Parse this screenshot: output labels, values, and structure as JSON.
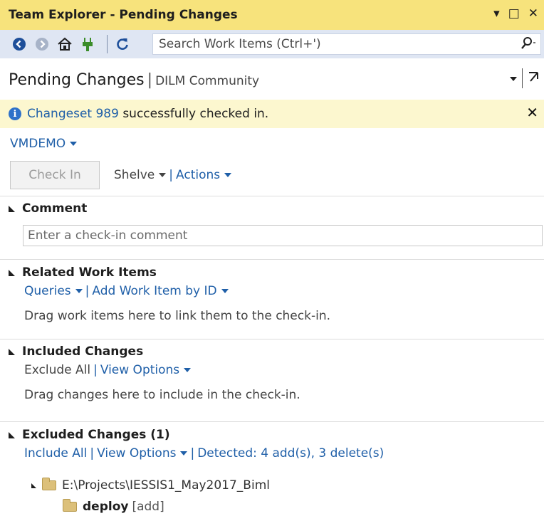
{
  "window": {
    "title": "Team Explorer - Pending Changes",
    "controls": [
      "▾",
      "□",
      "✕"
    ]
  },
  "toolbar": {
    "search_placeholder": "Search Work Items (Ctrl+')",
    "icons": [
      "back-icon",
      "forward-icon",
      "home-icon",
      "connect-icon",
      "refresh-icon",
      "search-icon"
    ]
  },
  "header": {
    "title": "Pending Changes",
    "separator": "|",
    "subtitle": "DILM Community"
  },
  "notification": {
    "link": "Changeset 989",
    "message": " successfully checked in."
  },
  "workspace": {
    "name": "VMDEMO"
  },
  "actions": {
    "check_in": "Check In",
    "shelve": "Shelve",
    "actions": "Actions"
  },
  "comment": {
    "title": "Comment",
    "placeholder": "Enter a check-in comment"
  },
  "related_work_items": {
    "title": "Related Work Items",
    "queries": "Queries",
    "add_by_id": "Add Work Item by ID",
    "hint": "Drag work items here to link them to the check-in."
  },
  "included_changes": {
    "title": "Included Changes",
    "exclude_all": "Exclude All",
    "view_options": "View Options",
    "hint": "Drag changes here to include in the check-in."
  },
  "excluded_changes": {
    "title": "Excluded Changes (1)",
    "include_all": "Include All",
    "view_options": "View Options",
    "detected": "Detected: 4 add(s), 3 delete(s)",
    "tree": [
      {
        "path": "E:\\Projects\\IESSIS1_May2017_Biml"
      },
      {
        "name": "deploy",
        "status": "[add]"
      }
    ]
  },
  "colors": {
    "title_bar": "#f7e37c",
    "toolbar": "#dfe6f3",
    "info_bar": "#fcf7cf",
    "link": "#1f5fa8"
  }
}
